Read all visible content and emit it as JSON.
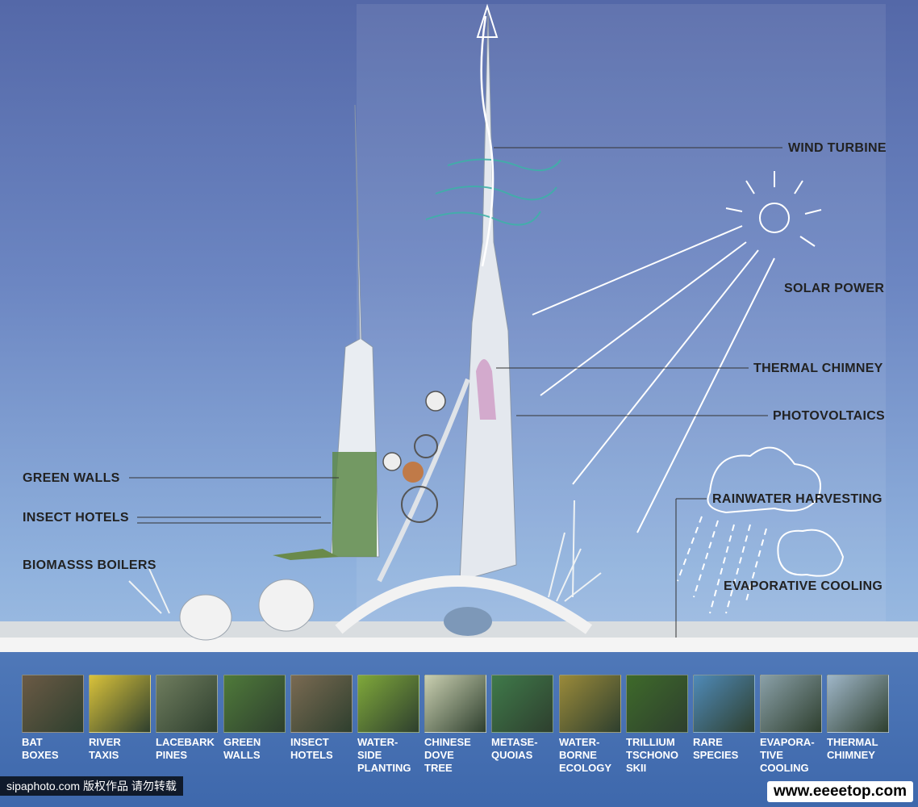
{
  "labels": {
    "wind_turbine": "WIND TURBINE",
    "solar_power": "SOLAR POWER",
    "thermal_chimney": "THERMAL CHIMNEY",
    "photovoltaics": "PHOTOVOLTAICS",
    "rainwater_harvesting": "RAINWATER HARVESTING",
    "evaporative_cooling": "EVAPORATIVE COOLING",
    "green_walls": "GREEN WALLS",
    "insect_hotels": "INSECT HOTELS",
    "biomass_boilers": "BIOMASSS BOILERS"
  },
  "legend": [
    {
      "caption": "BAT\nBOXES",
      "color": "#6b5a45"
    },
    {
      "caption": "RIVER\nTAXIS",
      "color": "#d9c23a"
    },
    {
      "caption": "LACEBARK\nPINES",
      "color": "#6f7d5e"
    },
    {
      "caption": "GREEN\nWALLS",
      "color": "#4f7a3a"
    },
    {
      "caption": "INSECT\nHOTELS",
      "color": "#7a6a52"
    },
    {
      "caption": "WATER-\nSIDE\nPLANTING",
      "color": "#7fa83a"
    },
    {
      "caption": "CHINESE\nDOVE\nTREE",
      "color": "#c9cfb0"
    },
    {
      "caption": "METASE-\nQUOIAS",
      "color": "#3f7a4a"
    },
    {
      "caption": "WATER-\nBORNE\nECOLOGY",
      "color": "#9a8a3a"
    },
    {
      "caption": "TRILLIUM\nTSCHONO\nSKII",
      "color": "#3e6a2a"
    },
    {
      "caption": "RARE\nSPECIES",
      "color": "#4f8ab8"
    },
    {
      "caption": "EVAPORA-\nTIVE\nCOOLING",
      "color": "#8aa0a8"
    },
    {
      "caption": "THERMAL\nCHIMNEY",
      "color": "#9fb6c8"
    }
  ],
  "watermarks": {
    "left": "sipaphoto.com 版权作品 请勿转载",
    "right": "www.eeeetop.com"
  }
}
